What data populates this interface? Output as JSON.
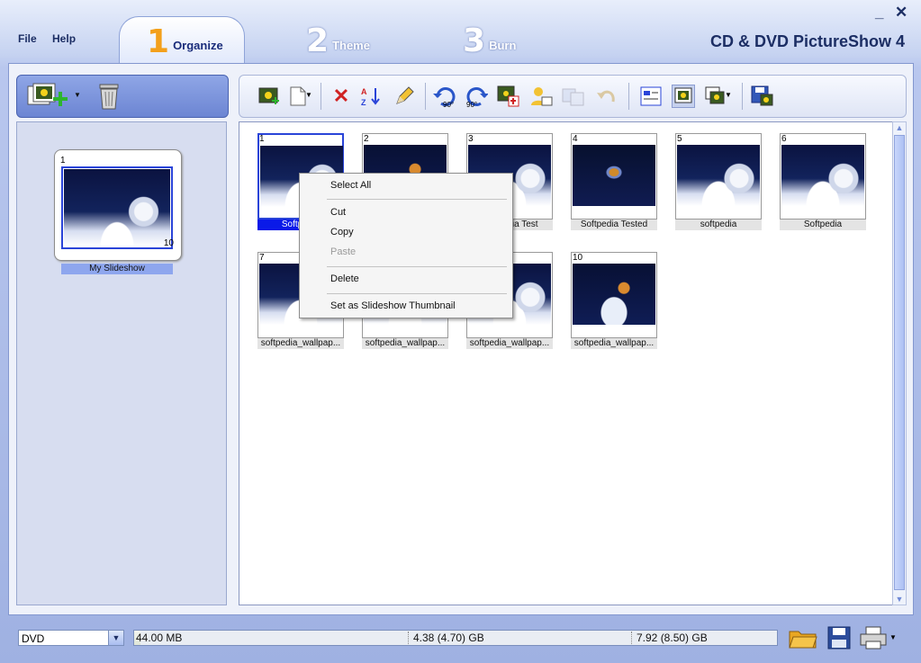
{
  "window": {
    "app_title": "CD & DVD PictureShow 4",
    "minimize_glyph": "_",
    "close_glyph": "✕"
  },
  "menu": {
    "file": "File",
    "help": "Help"
  },
  "tabs": [
    {
      "num": "1",
      "label": "Organize",
      "active": true
    },
    {
      "num": "2",
      "label": "Theme",
      "active": false
    },
    {
      "num": "3",
      "label": "Burn",
      "active": false
    }
  ],
  "left_toolbar": {
    "icons": [
      "add-slideshow-icon",
      "recycle-bin-icon"
    ]
  },
  "slideshows": [
    {
      "index": "1",
      "count": "10",
      "caption": "My Slideshow"
    }
  ],
  "toolbar": {
    "icons": [
      "add-photo-icon",
      "new-page-icon",
      "delete-icon",
      "sort-icon",
      "edit-icon",
      "rotate-left-icon",
      "rotate-right-icon",
      "add-to-slideshow-icon",
      "user-icon",
      "copy-disabled-icon",
      "undo-disabled-icon",
      "view-details-icon",
      "view-thumbnails-icon",
      "view-options-icon",
      "save-icon"
    ],
    "rotate_left_label": "90°",
    "rotate_right_label": "90°"
  },
  "photos": [
    {
      "index": "1",
      "caption": "Softpedia",
      "selected": true,
      "style": "a"
    },
    {
      "index": "2",
      "caption": "",
      "selected": false,
      "style": "b"
    },
    {
      "index": "3",
      "caption": "Softpedia Test",
      "selected": false,
      "style": "a"
    },
    {
      "index": "4",
      "caption": "Softpedia Tested",
      "selected": false,
      "style": "c"
    },
    {
      "index": "5",
      "caption": "softpedia",
      "selected": false,
      "style": "a"
    },
    {
      "index": "6",
      "caption": "Softpedia",
      "selected": false,
      "style": "a"
    },
    {
      "index": "7",
      "caption": "softpedia_wallpap...",
      "selected": false,
      "style": "a"
    },
    {
      "index": "8",
      "caption": "softpedia_wallpap...",
      "selected": false,
      "style": "a"
    },
    {
      "index": "9",
      "caption": "softpedia_wallpap...",
      "selected": false,
      "style": "a"
    },
    {
      "index": "10",
      "caption": "softpedia_wallpap...",
      "selected": false,
      "style": "b"
    }
  ],
  "context_menu": {
    "select_all": "Select All",
    "cut": "Cut",
    "copy": "Copy",
    "paste": "Paste",
    "delete": "Delete",
    "set_thumbnail": "Set as Slideshow Thumbnail"
  },
  "status": {
    "disc_type": "DVD",
    "used": "44.00 MB",
    "single_layer": "4.38 (4.70) GB",
    "dual_layer": "7.92 (8.50) GB",
    "used_fraction": 0.01,
    "icons": [
      "open-folder-icon",
      "save-disk-icon",
      "print-icon"
    ]
  },
  "colors": {
    "accent": "#2a44d8",
    "selection": "#0a1ae8",
    "tab_number": "#f3a01b"
  }
}
